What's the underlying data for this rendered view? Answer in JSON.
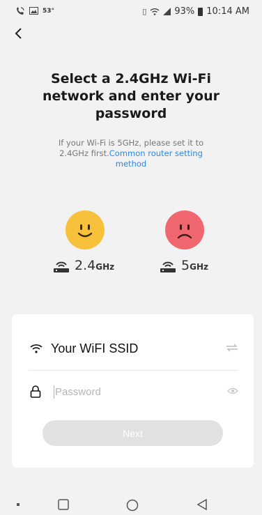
{
  "status_bar": {
    "temperature": "53°",
    "battery": "93%",
    "time": "10:14 AM"
  },
  "header": {
    "title": "Select a 2.4GHz Wi-Fi network and enter your password",
    "subtitle_text": "If your Wi-Fi is 5GHz, please set it to 2.4GHz first.",
    "subtitle_link": "Common router setting method"
  },
  "bands": {
    "supported": {
      "value": "2.4",
      "unit": "GHz"
    },
    "unsupported": {
      "value": "5",
      "unit": "GHz"
    }
  },
  "form": {
    "ssid": "Your WiFI SSID",
    "password_placeholder": "Password",
    "next_label": "Next"
  },
  "colors": {
    "background": "#f2f2f2",
    "happy_face": "#f7c13b",
    "sad_face": "#f0676f",
    "link": "#2b88e6",
    "button_disabled": "#e1e1e1"
  }
}
